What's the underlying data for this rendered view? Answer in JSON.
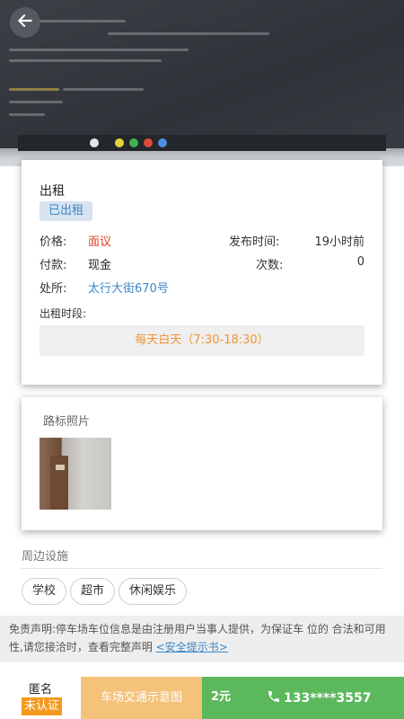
{
  "header": {
    "back_icon": "arrow-left-icon"
  },
  "listing": {
    "title": "出租",
    "status": "已出租",
    "price_label": "价格:",
    "price_value": "面议",
    "publish_label": "发布时间:",
    "publish_value": "19小时前",
    "payment_label": "付款:",
    "payment_value": "现金",
    "count_label": "次数:",
    "count_value": "0",
    "location_label": "处所:",
    "location_value": "太行大街670号",
    "period_label": "出租时段:",
    "period_value": "每天白天（7:30-18:30）"
  },
  "photos": {
    "title": "路标照片"
  },
  "facilities": {
    "title": "周边设施",
    "tags": [
      "学校",
      "超市",
      "休闲娱乐"
    ]
  },
  "disclaimer": {
    "text": "免责声明:停车场车位信息是由注册用户当事人提供，为保证车 位的 合法和可用性,请您接洽时，查看完整声明",
    "link": "<安全提示书>"
  },
  "bottom_bar": {
    "anon_name": "匿名",
    "anon_badge": "未认证",
    "traffic_label": "车场交通示意图",
    "price": "2元",
    "phone": "133****3557"
  },
  "colors": {
    "accent_blue": "#3a87c8",
    "price_red": "#e2412a",
    "period_orange": "#f0952f",
    "badge_orange": "#f39a1e",
    "call_green": "#5cb85c",
    "traffic_tan": "#f5c27a"
  }
}
